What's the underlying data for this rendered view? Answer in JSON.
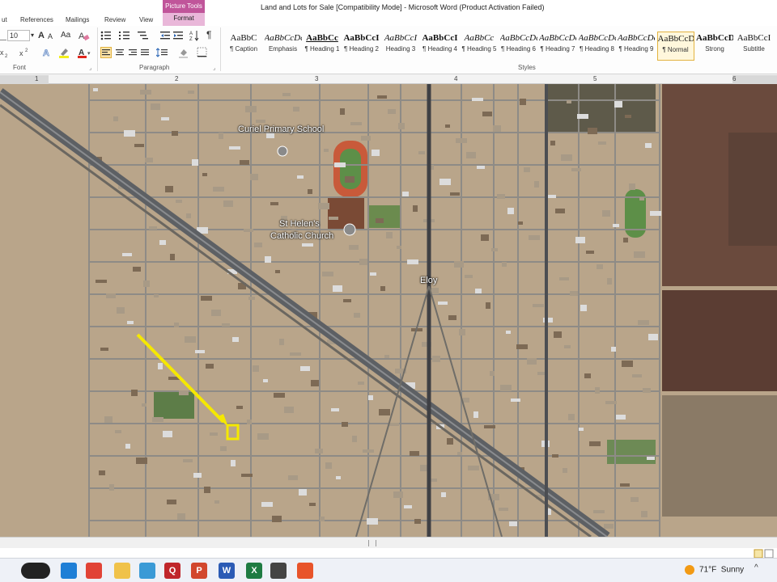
{
  "window": {
    "title": "Land and Lots for Sale [Compatibility Mode]  -  Microsoft Word (Product Activation Failed)"
  },
  "tabs": {
    "items": [
      "ut",
      "References",
      "Mailings",
      "Review",
      "View"
    ],
    "contextual_group": "Picture Tools",
    "contextual_tab": "Format"
  },
  "ribbon": {
    "font_size": "10",
    "grow_font": "A",
    "shrink_font": "A",
    "change_case": "Aa",
    "pilcrow": "¶",
    "group_font": "Font",
    "group_paragraph": "Paragraph",
    "group_styles": "Styles",
    "styles": [
      {
        "sample": "AaBbC",
        "name": "¶ Caption"
      },
      {
        "sample": "AaBbCcDc",
        "name": "Emphasis"
      },
      {
        "sample": "AaBbCc",
        "name": "¶ Heading 1"
      },
      {
        "sample": "AaBbCcI",
        "name": "¶ Heading 2"
      },
      {
        "sample": "AaBbCcI",
        "name": "Heading 3"
      },
      {
        "sample": "AaBbCcI",
        "name": "¶ Heading 4"
      },
      {
        "sample": "AaBbCc",
        "name": "¶ Heading 5"
      },
      {
        "sample": "AaBbCcDc",
        "name": "¶ Heading 6"
      },
      {
        "sample": "AaBbCcDc",
        "name": "¶ Heading 7"
      },
      {
        "sample": "AaBbCcDc",
        "name": "¶ Heading 8"
      },
      {
        "sample": "AaBbCcDc",
        "name": "¶ Heading 9"
      },
      {
        "sample": "AaBbCcDc",
        "name": "¶ Normal"
      },
      {
        "sample": "AaBbCcDd",
        "name": "Strong"
      },
      {
        "sample": "AaBbCcI",
        "name": "Subtitle"
      }
    ],
    "selected_style": "¶ Normal"
  },
  "ruler": {
    "numbers": [
      "1",
      "2",
      "3",
      "4",
      "5",
      "6"
    ]
  },
  "map": {
    "labels": {
      "school": "Curiel Primary School",
      "church_line1": "St Helen's",
      "church_line2": "Catholic Church",
      "town": "Eloy"
    },
    "colors": {
      "desert": "#b9a58a",
      "road": "#8e8b86",
      "highway": "#6b6d70",
      "field": "#5a3e33",
      "marker": "#f5e800"
    }
  },
  "taskbar": {
    "apps": [
      {
        "icon": "copilot-icon",
        "label": ""
      },
      {
        "icon": "edge-icon",
        "label": ""
      },
      {
        "icon": "chrome-icon",
        "label": ""
      },
      {
        "icon": "file-explorer-icon",
        "label": ""
      },
      {
        "icon": "photos-icon",
        "label": ""
      },
      {
        "icon": "quicken-icon",
        "label": "Q"
      },
      {
        "icon": "powerpoint-icon",
        "label": "P"
      },
      {
        "icon": "word-icon",
        "label": "W"
      },
      {
        "icon": "excel-icon",
        "label": "X"
      },
      {
        "icon": "car-icon",
        "label": ""
      },
      {
        "icon": "brave-icon",
        "label": ""
      }
    ],
    "weather_temp": "71°F",
    "weather_text": "Sunny"
  }
}
